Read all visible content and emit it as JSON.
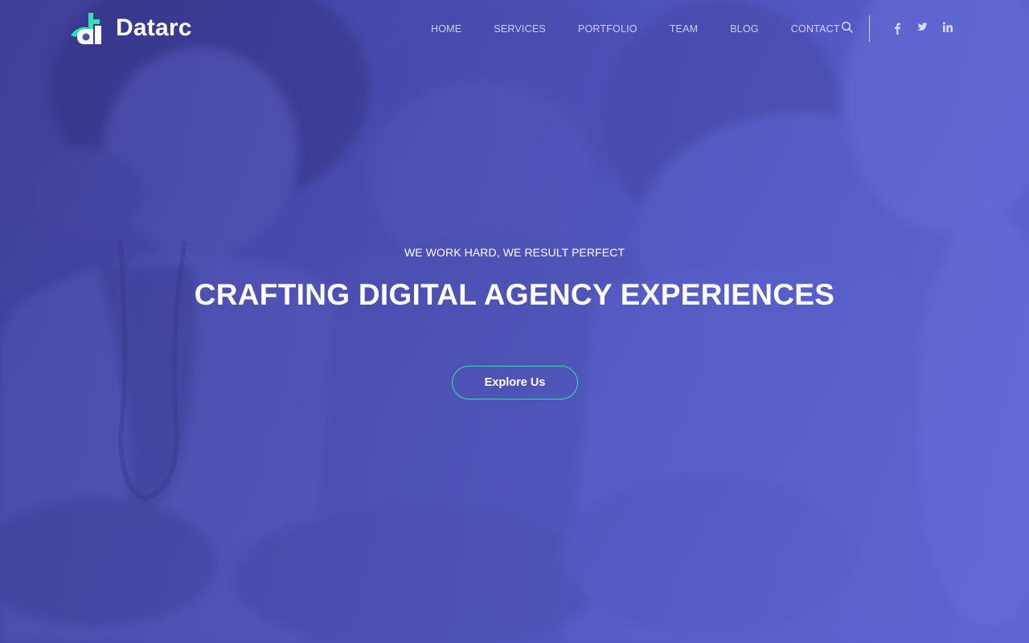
{
  "brand": {
    "name": "Datarc",
    "accent_color": "#2fe3b0",
    "icon": "datarc-logo-icon"
  },
  "nav": {
    "items": [
      {
        "label": "HOME"
      },
      {
        "label": "SERVICES"
      },
      {
        "label": "PORTFOLIO"
      },
      {
        "label": "TEAM"
      },
      {
        "label": "BLOG"
      },
      {
        "label": "CONTACT"
      }
    ],
    "search_icon": "search-icon"
  },
  "social": [
    {
      "icon": "facebook-icon"
    },
    {
      "icon": "twitter-icon"
    },
    {
      "icon": "linkedin-icon"
    }
  ],
  "hero": {
    "tagline": "WE WORK HARD, WE RESULT PERFECT",
    "headline": "CRAFTING DIGITAL AGENCY EXPERIENCES",
    "cta_label": "Explore Us",
    "overlay_color": "#4d51b6"
  }
}
